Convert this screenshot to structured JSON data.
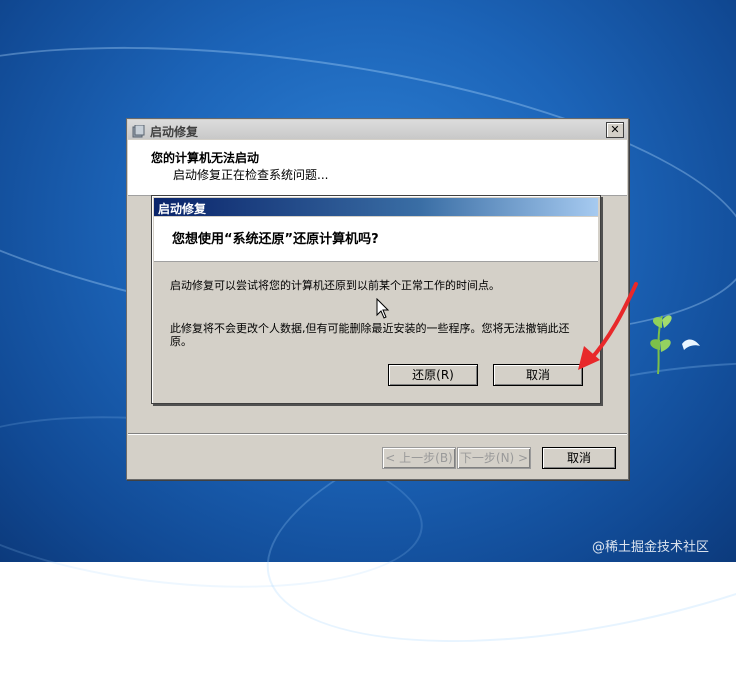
{
  "main_window": {
    "title": "启动修复",
    "header_title": "您的计算机无法启动",
    "header_status": "启动修复正在检查系统问题...",
    "buttons": {
      "prev": "< 上一步(B)",
      "next": "下一步(N) >",
      "cancel": "取消"
    }
  },
  "dialog": {
    "title": "启动修复",
    "question": "您想使用“系统还原”还原计算机吗?",
    "body_line1": "启动修复可以尝试将您的计算机还原到以前某个正常工作的时间点。",
    "body_line2": "此修复将不会更改个人数据,但有可能删除最近安装的一些程序。您将无法撤销此还原。",
    "buttons": {
      "restore": "还原(R)",
      "cancel": "取消"
    }
  },
  "watermark": "@稀土掘金技术社区",
  "icons": {
    "close": "close-icon",
    "app": "startup-repair-icon",
    "cursor": "mouse-cursor-icon",
    "arrow": "red-arrow-annotation"
  },
  "colors": {
    "desktop": "#1c64b8",
    "dialog_title": "#0a246a",
    "annotation_arrow": "#e8282a"
  }
}
